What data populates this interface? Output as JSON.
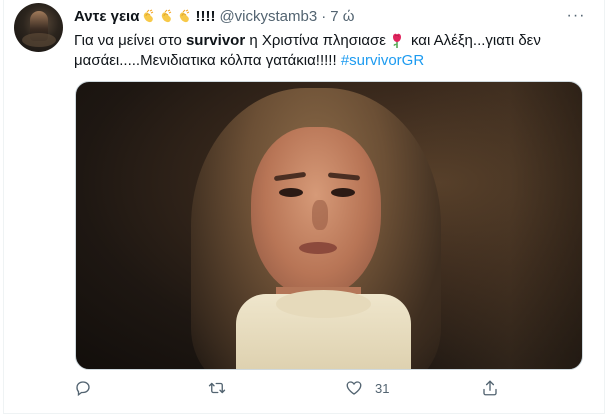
{
  "tweet": {
    "author_name": "Αντε γεια",
    "author_name_suffix": "!!!!",
    "name_emojis": [
      "clapping-hands",
      "clapping-hands",
      "clapping-hands"
    ],
    "handle": "@vickystamb3",
    "separator": "·",
    "timestamp": "7 ώ",
    "more_label": "···",
    "text": {
      "part1": "Για να μείνει στο ",
      "bold": "survivor",
      "part2": " η Χριστίνα πλησιασε",
      "emoji": "rose",
      "part3": "και Αλέξη...γιατι δεν μασάει.....Μενιδιατικα κόλπα γατάκια!!!!! ",
      "hashtag": "#survivorGR"
    },
    "media_alt": "video still of a woman in a cream turtleneck"
  },
  "actions": {
    "reply_count": "",
    "retweet_count": "",
    "like_count": "31",
    "share_count": ""
  },
  "colors": {
    "text": "#0f1419",
    "secondary": "#536471",
    "link": "#1d9bf0",
    "border": "#cfd9de"
  }
}
